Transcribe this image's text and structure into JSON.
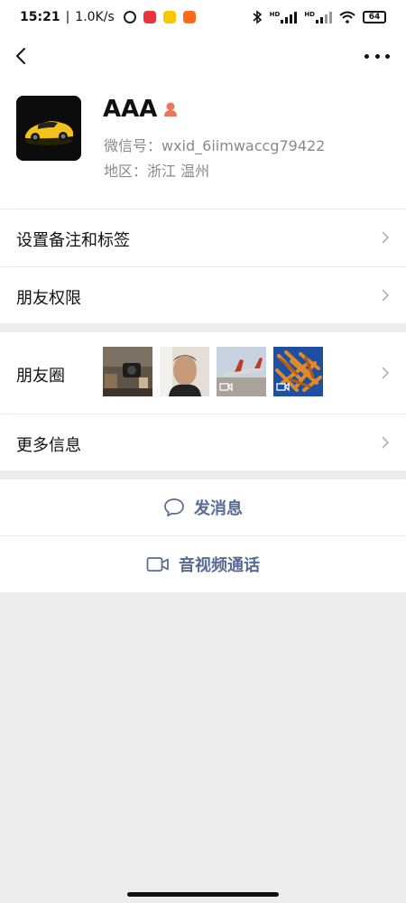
{
  "status_bar": {
    "time": "15:21",
    "speed": "1.0K/s",
    "battery": "64",
    "hd1": "HD",
    "hd2": "HD"
  },
  "profile": {
    "name": "AAA",
    "wechat_id": "微信号：wxid_6iimwaccg79422",
    "region": "地区：浙江  温州"
  },
  "rows": {
    "set_remark": "设置备注和标签",
    "friend_permission": "朋友权限",
    "moments": "朋友圈",
    "more_info": "更多信息"
  },
  "actions": {
    "message": "发消息",
    "video_call": "音视频通话"
  },
  "colors": {
    "link": "#576b95",
    "background": "#ededed"
  }
}
